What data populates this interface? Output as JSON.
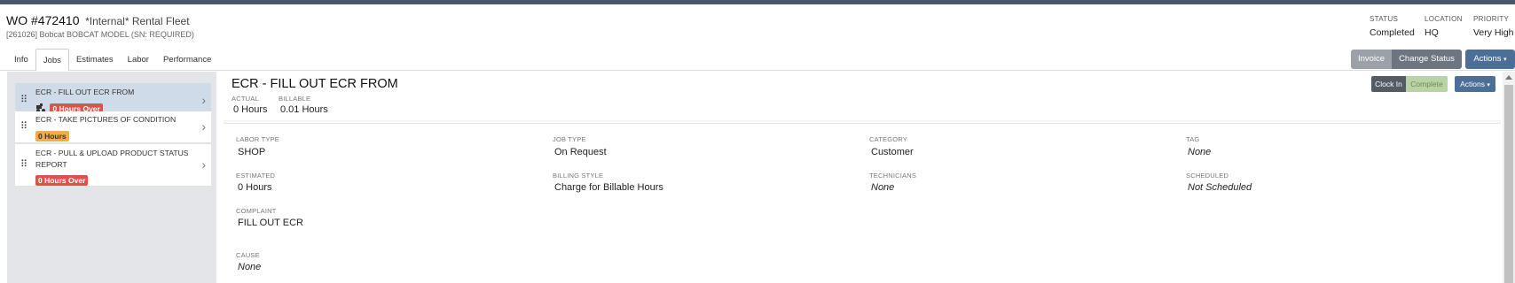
{
  "workorder": {
    "number": "WO #472410",
    "fleet": "*Internal* Rental Fleet",
    "subtitle": "[261026] Bobcat BOBCAT MODEL (SN: REQUIRED)"
  },
  "status_info": {
    "status_label": "STATUS",
    "status_value": "Completed",
    "location_label": "LOCATION",
    "location_value": "HQ",
    "priority_label": "PRIORITY",
    "priority_value": "Very High"
  },
  "tabs": [
    {
      "label": "Info",
      "active": false
    },
    {
      "label": "Jobs",
      "active": true
    },
    {
      "label": "Estimates",
      "active": false
    },
    {
      "label": "Labor",
      "active": false
    },
    {
      "label": "Performance",
      "active": false
    }
  ],
  "header_buttons": {
    "invoice": "Invoice",
    "change_status": "Change Status",
    "actions": "Actions"
  },
  "jobs": [
    {
      "title": "ECR - FILL OUT ECR FROM",
      "badge": "0 Hours Over",
      "badge_color": "#d9534f",
      "icon": "tractor-icon",
      "selected": true
    },
    {
      "title": "ECR - TAKE PICTURES OF CONDITION",
      "badge": "0 Hours",
      "badge_color": "#f0ad4e",
      "selected": false
    },
    {
      "title": "ECR - PULL & UPLOAD PRODUCT STATUS REPORT",
      "badge": "0 Hours Over",
      "badge_color": "#d9534f",
      "selected": false
    }
  ],
  "job_detail": {
    "title": "ECR - FILL OUT ECR FROM",
    "actual_label": "ACTUAL",
    "actual_value": "0 Hours",
    "billable_label": "BILLABLE",
    "billable_value": "0.01 Hours",
    "clock_in": "Clock In",
    "complete": "Complete",
    "actions": "Actions",
    "fields": {
      "labor_type_label": "LABOR TYPE",
      "labor_type": "SHOP",
      "job_type_label": "JOB TYPE",
      "job_type": "On Request",
      "category_label": "CATEGORY",
      "category": "Customer",
      "tag_label": "TAG",
      "tag": "None",
      "estimated_label": "ESTIMATED",
      "estimated": "0 Hours",
      "billing_style_label": "BILLING STYLE",
      "billing_style": "Charge for Billable Hours",
      "technicians_label": "TECHNICIANS",
      "technicians": "None",
      "scheduled_label": "SCHEDULED",
      "scheduled": "Not Scheduled",
      "complaint_label": "COMPLAINT",
      "complaint": "FILL OUT ECR",
      "cause_label": "CAUSE",
      "cause": "None"
    }
  },
  "colors": {
    "accent": "#4b6f96",
    "badge_red": "#d9534f",
    "badge_orange": "#f0ad4e",
    "complete_green": "#b9d3a4"
  }
}
